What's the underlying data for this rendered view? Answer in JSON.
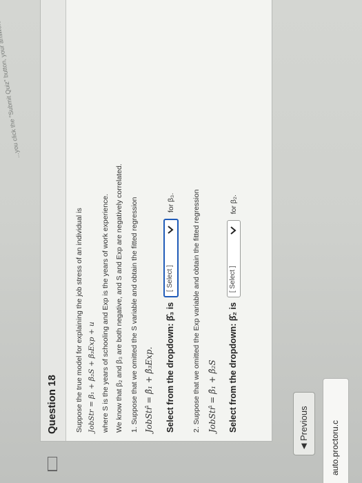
{
  "header": {
    "partial_text": "...you click the \"Submit Quiz\" button, your answers will"
  },
  "question": {
    "title": "Question 18",
    "intro": "Suppose the true model for explaining the job stress of an individual is",
    "model": "JobStr = β₁ + β₂S + β₃Exp + u",
    "where": "where S is the years of schooling and Exp is the years of work experience.",
    "know": "We know that β₂ and β₃ are both negative, and S and Exp are negatively correlated.",
    "part1": "1. Suppose that we omitted the S variable and obtain the fitted regression",
    "eq1": "JobStr̂ = β̂₁ + β̂₃Exp.",
    "select1_prompt": "Select from the dropdown: β̂₃ is",
    "select1_value": "[ Select ]",
    "select1_suffix": "for β₃.",
    "part2": "2. Suppose that we omitted the Exp variable and obtain the fitted regression",
    "eq2": "JobStr̂ = β̂₁ + β̂₂S",
    "select2_prompt": "Select from the dropdown: β̂₂ is",
    "select2_value": "[ Select ]",
    "select2_suffix": "for β₂."
  },
  "nav": {
    "previous_label": "Previous",
    "previous_icon": "left-triangle-icon"
  },
  "proctor": {
    "label": "auto.proctoru.c",
    "icon": "pause-icon"
  }
}
